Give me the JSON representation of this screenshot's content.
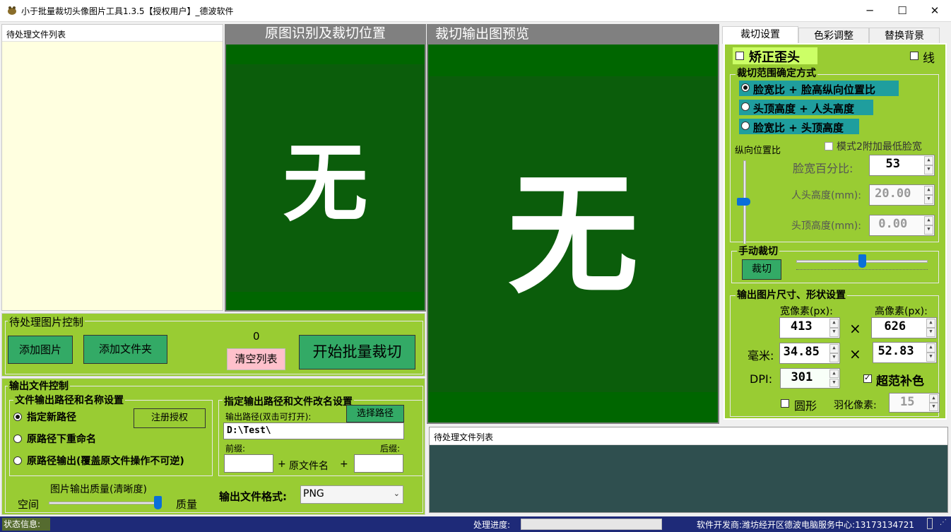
{
  "window": {
    "title": "小于批量裁切头像图片工具1.3.5【授权用户】_德波软件",
    "minimize": "─",
    "maximize": "☐",
    "close": "✕"
  },
  "colors": {
    "panel_green": "#99cc33",
    "preview_green": "#006600",
    "status_bar": "#1e2a78",
    "button_green": "#33a864"
  },
  "file_list": {
    "header": "待处理文件列表"
  },
  "original_view": {
    "title": "原图识别及裁切位置",
    "placeholder": "无"
  },
  "output_view": {
    "title": "裁切输出图预览",
    "placeholder": "无"
  },
  "image_control": {
    "group": "待处理图片控制",
    "add_image": "添加图片",
    "add_folder": "添加文件夹",
    "count": "0",
    "clear_list": "清空列表",
    "start": "开始批量裁切"
  },
  "output_control": {
    "group": "输出文件控制",
    "path_group": "文件输出路径和名称设置",
    "options": [
      "指定新路径",
      "原路径下重命名",
      "原路径输出(覆盖原文件操作不可逆)"
    ],
    "selected_option": 0,
    "register": "注册授权",
    "rename_group": "指定输出路径和文件改名设置",
    "path_label": "输出路径(双击可打开):",
    "choose_path": "选择路径",
    "path_value": "D:\\Test\\",
    "prefix_label": "前缀:",
    "suffix_label": "后缀:",
    "plus1": "+",
    "orig_name": "原文件名",
    "plus2": "+",
    "quality_label": "图片输出质量(清晰度)",
    "quality_left": "空间",
    "quality_right": "质量",
    "quality_level": 1.0,
    "format_label": "输出文件格式:",
    "format_value": "PNG"
  },
  "tabs": [
    "裁切设置",
    "色彩调整",
    "替换背景"
  ],
  "crop": {
    "fix_tilt": "矫正歪头",
    "line": "线",
    "range_group": "裁切范围确定方式",
    "range_options": [
      "脸宽比 + 脸高纵向位置比",
      "头顶高度 + 人头高度",
      "脸宽比 + 头顶高度"
    ],
    "range_selected": 0,
    "mode2_min": "模式2附加最低脸宽",
    "vertical_ratio": "纵向位置比",
    "vertical_level": 0.55,
    "face_width_label": "脸宽百分比:",
    "face_width_value": "53",
    "head_height_label": "人头高度(mm):",
    "head_height_value": "20.00",
    "top_height_label": "头顶高度(mm):",
    "top_height_value": "0.00",
    "manual_group": "手动裁切",
    "manual_button": "裁切",
    "manual_level": 0.5
  },
  "size": {
    "group": "输出图片尺寸、形状设置",
    "width_label": "宽像素(px):",
    "height_label": "高像素(px):",
    "width_px": "413",
    "height_px": "626",
    "times1": "×",
    "mm_label": "毫米:",
    "width_mm": "34.85",
    "height_mm": "52.83",
    "times2": "×",
    "dpi_label": "DPI:",
    "dpi_value": "301",
    "overflow_fill": "超范补色",
    "round": "圆形",
    "feather_label": "羽化像素:",
    "feather_value": "15"
  },
  "bottom_list": {
    "header": "待处理文件列表"
  },
  "status": {
    "info_label": "状态信息:",
    "progress_label": "处理进度:",
    "developer": "软件开发商:潍坊经开区德波电脑服务中心:13173134721"
  }
}
